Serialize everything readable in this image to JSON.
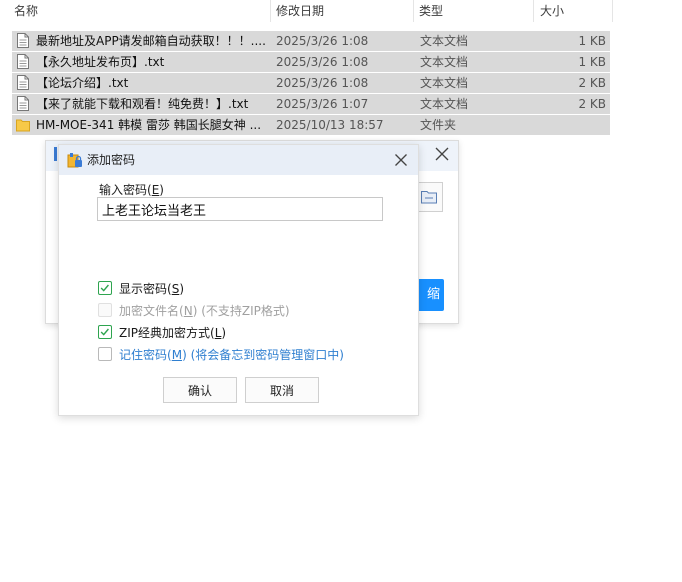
{
  "columns": [
    "名称",
    "修改日期",
    "类型",
    "大小"
  ],
  "files": [
    {
      "name": "最新地址及APP请发邮箱自动获取！！！....",
      "date": "2025/3/26 1:08",
      "type": "文本文档",
      "size": "1 KB",
      "icon": "text-file-icon"
    },
    {
      "name": "【永久地址发布页】.txt",
      "date": "2025/3/26 1:08",
      "type": "文本文档",
      "size": "1 KB",
      "icon": "text-file-icon"
    },
    {
      "name": "【论坛介绍】.txt",
      "date": "2025/3/26 1:08",
      "type": "文本文档",
      "size": "2 KB",
      "icon": "text-file-icon"
    },
    {
      "name": "【来了就能下载和观看！纯免费！】.txt",
      "date": "2025/3/26 1:07",
      "type": "文本文档",
      "size": "2 KB",
      "icon": "text-file-icon"
    },
    {
      "name": "HM-MOE-341 韩模 雷莎 韩国长腿女神 ...",
      "date": "2025/10/13 18:57",
      "type": "文件夹",
      "size": "",
      "icon": "folder-icon"
    }
  ],
  "back_dialog": {
    "button_label": "缩"
  },
  "dialog": {
    "title": "添加密码",
    "password_label": "输入密码",
    "password_label_key": "E",
    "password_value": "上老王论坛当老王",
    "options": {
      "show_password": {
        "label": "显示密码",
        "key": "S",
        "checked": true
      },
      "encrypt_filenames": {
        "label": "加密文件名",
        "key": "N",
        "note": "(不支持ZIP格式)",
        "checked": false,
        "disabled": true
      },
      "zip_classic": {
        "label": "ZIP经典加密方式",
        "key": "L",
        "checked": true
      },
      "remember_password": {
        "label": "记住密码",
        "key": "M",
        "note": "(将会备忘到密码管理窗口中)",
        "checked": false
      }
    },
    "confirm_label": "确认",
    "cancel_label": "取消"
  },
  "colors": {
    "row_selected": "#d9d9d9",
    "titlebar": "#e8eef7",
    "check_green": "#2ea44f",
    "accent_blue": "#1890ff",
    "link_blue": "#2f7fd0",
    "folder_yellow": "#f7c948"
  }
}
